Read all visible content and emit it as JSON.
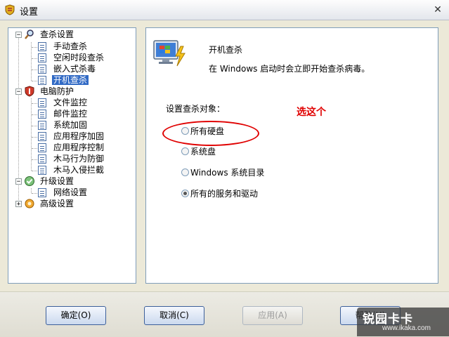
{
  "window": {
    "title": "设置",
    "close_label": "✕"
  },
  "tree": {
    "groups": [
      {
        "label": "查杀设置",
        "expanded": true,
        "items": [
          "手动查杀",
          "空闲时段查杀",
          "嵌入式杀毒",
          "开机查杀"
        ]
      },
      {
        "label": "电脑防护",
        "expanded": true,
        "items": [
          "文件监控",
          "邮件监控",
          "系统加固",
          "应用程序加固",
          "应用程序控制",
          "木马行为防御",
          "木马入侵拦截"
        ]
      },
      {
        "label": "升级设置",
        "expanded": true,
        "items": [
          "网络设置"
        ]
      },
      {
        "label": "高级设置",
        "expanded": false,
        "items": []
      }
    ],
    "selected": "开机查杀"
  },
  "panel": {
    "title": "开机查杀",
    "description": "在 Windows 启动时会立即开始查杀病毒。",
    "section_label": "设置查杀对象：",
    "options": [
      "所有硬盘",
      "系统盘",
      "Windows 系统目录",
      "所有的服务和驱动"
    ],
    "selected_option": "所有的服务和驱动",
    "annotation": "选这个"
  },
  "buttons": {
    "ok": "确定(O)",
    "cancel": "取消(C)",
    "apply": "应用(A)",
    "help": "帮助(H)"
  },
  "watermark": {
    "brand": "锐园卡卡",
    "url": "www.ikaka.com"
  },
  "colors": {
    "selection": "#316ac5",
    "annotation": "#e00000"
  }
}
